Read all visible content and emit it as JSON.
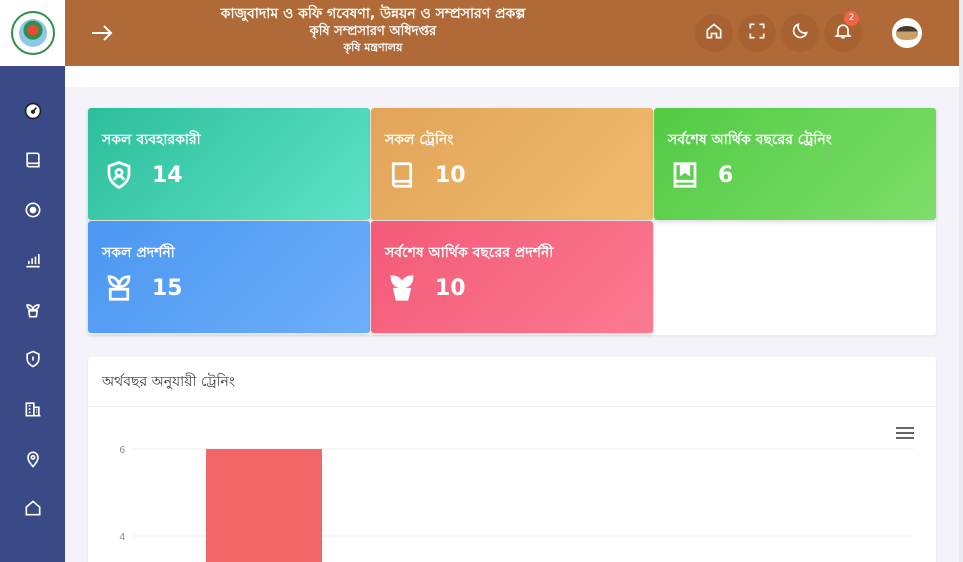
{
  "header": {
    "title_line1": "কাজুবাদাম ও কফি গবেষণা, উন্নয়ন ও সম্প্রসারণ প্রকল্প",
    "title_line2": "কৃষি সম্প্রসারণ অধিদপ্তর",
    "title_line3": "কৃষি মন্ত্রণালয়",
    "notification_count": "2"
  },
  "sidebar": {
    "items": [
      {
        "icon": "dashboard-gauge-icon"
      },
      {
        "icon": "book-icon"
      },
      {
        "icon": "target-icon"
      },
      {
        "icon": "bar-chart-icon"
      },
      {
        "icon": "plant-icon"
      },
      {
        "icon": "shield-icon"
      },
      {
        "icon": "building-icon"
      },
      {
        "icon": "location-pin-icon"
      },
      {
        "icon": "home-icon"
      }
    ]
  },
  "cards": [
    {
      "title": "সকল ব্যবহারকারী",
      "value": "14",
      "icon": "user-shield-icon",
      "color": "#2cbe9a"
    },
    {
      "title": "সকল ট্রেনিং",
      "value": "10",
      "icon": "book-icon",
      "color": "#e2a458"
    },
    {
      "title": "সর্বশেষ আর্থিক বছরের ট্রেনিং",
      "value": "6",
      "icon": "bookmark-book-icon",
      "color": "#52cb45"
    },
    {
      "title": "সকল প্রদর্শনী",
      "value": "15",
      "icon": "plant-icon",
      "color": "#4b97f2"
    },
    {
      "title": "সর্বশেষ আর্থিক বছরের প্রদর্শনী",
      "value": "10",
      "icon": "potted-plant-icon",
      "color": "#f35a78"
    }
  ],
  "chart": {
    "title": "অর্থবছর অনুযায়ী ট্রেনিং"
  },
  "chart_data": {
    "type": "bar",
    "title": "অর্থবছর অনুযায়ী ট্রেনিং",
    "xlabel": "",
    "ylabel": "",
    "y_ticks": [
      4,
      6
    ],
    "categories": [
      ""
    ],
    "values": [
      6
    ],
    "color": "#f26666",
    "grid": true
  }
}
